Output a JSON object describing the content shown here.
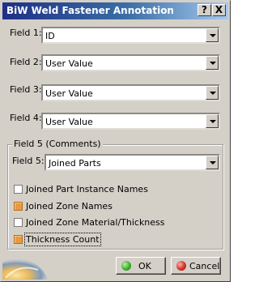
{
  "window": {
    "title": "BiW Weld Fastener Annotation",
    "help_label": "?",
    "close_label": "X"
  },
  "fields": [
    {
      "label": "Field 1:",
      "value": "ID"
    },
    {
      "label": "Field 2:",
      "value": "User Value"
    },
    {
      "label": "Field 3:",
      "value": "User Value"
    },
    {
      "label": "Field 4:",
      "value": "User Value"
    }
  ],
  "comments": {
    "group_title": "Field 5 (Comments)",
    "field_label": "Field 5:",
    "field_value": "Joined Parts",
    "options": [
      {
        "label": "Joined Part Instance Names",
        "checked": false
      },
      {
        "label": "Joined Zone Names",
        "checked": true
      },
      {
        "label": "Joined Zone Material/Thickness",
        "checked": false
      },
      {
        "label": "Thickness Count",
        "checked": true
      }
    ]
  },
  "buttons": {
    "ok_label": "OK",
    "cancel_label": "Cancel"
  },
  "colors": {
    "title_bar_start": "#1f2f86",
    "title_bar_end": "#a6caf0",
    "dialog_bg": "#d4d0c8",
    "checked_box": "#e89a42"
  }
}
